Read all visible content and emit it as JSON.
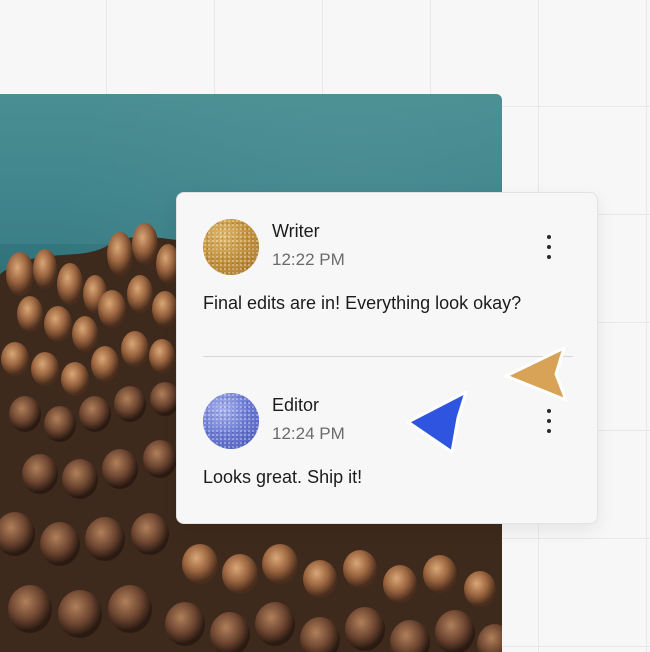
{
  "comments": [
    {
      "author": "Writer",
      "time": "12:22 PM",
      "message": "Final edits are in! Everything look okay?",
      "avatar_color": "#c8943c",
      "menu_icon": "more-vertical-icon"
    },
    {
      "author": "Editor",
      "time": "12:24 PM",
      "message": "Looks great. Ship it!",
      "avatar_color": "#6f7fd8",
      "menu_icon": "more-vertical-icon"
    }
  ],
  "cursors": [
    {
      "owner": "Writer",
      "color": "#d9a357",
      "icon": "pointer-cursor-icon"
    },
    {
      "owner": "Editor",
      "color": "#2f55e0",
      "icon": "pointer-cursor-icon"
    }
  ],
  "colors": {
    "canvas": "#f8f7f7",
    "grid": "#e9e7e7",
    "card": "#f8f7f7",
    "text": "#1c1c1c",
    "muted_text": "#6b6b6b"
  }
}
